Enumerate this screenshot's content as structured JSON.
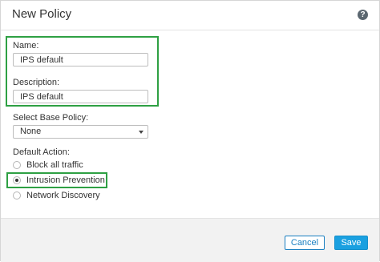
{
  "dialog": {
    "title": "New Policy",
    "help_icon": "help-icon"
  },
  "form": {
    "name_label": "Name:",
    "name_value": "IPS default",
    "description_label": "Description:",
    "description_value": "IPS default",
    "base_policy_label": "Select Base Policy:",
    "base_policy_selected": "None",
    "default_action_label": "Default Action:",
    "actions": [
      {
        "label": "Block all traffic",
        "checked": false
      },
      {
        "label": "Intrusion Prevention",
        "checked": true
      },
      {
        "label": "Network Discovery",
        "checked": false
      }
    ]
  },
  "footer": {
    "cancel_label": "Cancel",
    "save_label": "Save"
  },
  "colors": {
    "highlight": "#2ea043",
    "primary": "#1aa0e0",
    "link": "#1a7fc1"
  }
}
